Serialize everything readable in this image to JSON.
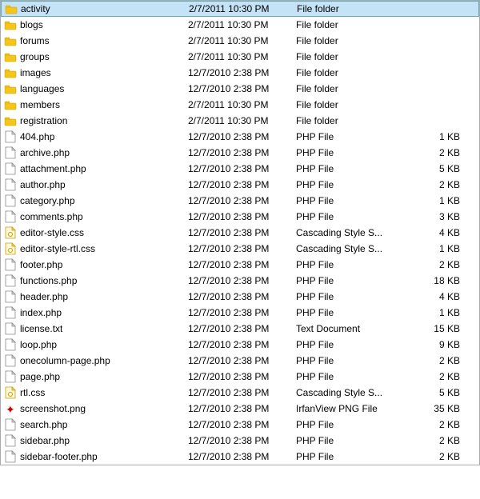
{
  "files": [
    {
      "name": "activity",
      "date": "2/7/2011 10:30 PM",
      "type": "File folder",
      "size": "",
      "icon": "folder"
    },
    {
      "name": "blogs",
      "date": "2/7/2011 10:30 PM",
      "type": "File folder",
      "size": "",
      "icon": "folder"
    },
    {
      "name": "forums",
      "date": "2/7/2011 10:30 PM",
      "type": "File folder",
      "size": "",
      "icon": "folder"
    },
    {
      "name": "groups",
      "date": "2/7/2011 10:30 PM",
      "type": "File folder",
      "size": "",
      "icon": "folder"
    },
    {
      "name": "images",
      "date": "12/7/2010 2:38 PM",
      "type": "File folder",
      "size": "",
      "icon": "folder"
    },
    {
      "name": "languages",
      "date": "12/7/2010 2:38 PM",
      "type": "File folder",
      "size": "",
      "icon": "folder"
    },
    {
      "name": "members",
      "date": "2/7/2011 10:30 PM",
      "type": "File folder",
      "size": "",
      "icon": "folder"
    },
    {
      "name": "registration",
      "date": "2/7/2011 10:30 PM",
      "type": "File folder",
      "size": "",
      "icon": "folder"
    },
    {
      "name": "404.php",
      "date": "12/7/2010 2:38 PM",
      "type": "PHP File",
      "size": "1 KB",
      "icon": "php"
    },
    {
      "name": "archive.php",
      "date": "12/7/2010 2:38 PM",
      "type": "PHP File",
      "size": "2 KB",
      "icon": "php"
    },
    {
      "name": "attachment.php",
      "date": "12/7/2010 2:38 PM",
      "type": "PHP File",
      "size": "5 KB",
      "icon": "php"
    },
    {
      "name": "author.php",
      "date": "12/7/2010 2:38 PM",
      "type": "PHP File",
      "size": "2 KB",
      "icon": "php"
    },
    {
      "name": "category.php",
      "date": "12/7/2010 2:38 PM",
      "type": "PHP File",
      "size": "1 KB",
      "icon": "php"
    },
    {
      "name": "comments.php",
      "date": "12/7/2010 2:38 PM",
      "type": "PHP File",
      "size": "3 KB",
      "icon": "php"
    },
    {
      "name": "editor-style.css",
      "date": "12/7/2010 2:38 PM",
      "type": "Cascading Style S...",
      "size": "4 KB",
      "icon": "css"
    },
    {
      "name": "editor-style-rtl.css",
      "date": "12/7/2010 2:38 PM",
      "type": "Cascading Style S...",
      "size": "1 KB",
      "icon": "css"
    },
    {
      "name": "footer.php",
      "date": "12/7/2010 2:38 PM",
      "type": "PHP File",
      "size": "2 KB",
      "icon": "php"
    },
    {
      "name": "functions.php",
      "date": "12/7/2010 2:38 PM",
      "type": "PHP File",
      "size": "18 KB",
      "icon": "php"
    },
    {
      "name": "header.php",
      "date": "12/7/2010 2:38 PM",
      "type": "PHP File",
      "size": "4 KB",
      "icon": "php"
    },
    {
      "name": "index.php",
      "date": "12/7/2010 2:38 PM",
      "type": "PHP File",
      "size": "1 KB",
      "icon": "php"
    },
    {
      "name": "license.txt",
      "date": "12/7/2010 2:38 PM",
      "type": "Text Document",
      "size": "15 KB",
      "icon": "txt"
    },
    {
      "name": "loop.php",
      "date": "12/7/2010 2:38 PM",
      "type": "PHP File",
      "size": "9 KB",
      "icon": "php"
    },
    {
      "name": "onecolumn-page.php",
      "date": "12/7/2010 2:38 PM",
      "type": "PHP File",
      "size": "2 KB",
      "icon": "php"
    },
    {
      "name": "page.php",
      "date": "12/7/2010 2:38 PM",
      "type": "PHP File",
      "size": "2 KB",
      "icon": "php"
    },
    {
      "name": "rtl.css",
      "date": "12/7/2010 2:38 PM",
      "type": "Cascading Style S...",
      "size": "5 KB",
      "icon": "css"
    },
    {
      "name": "screenshot.png",
      "date": "12/7/2010 2:38 PM",
      "type": "IrfanView PNG File",
      "size": "35 KB",
      "icon": "png"
    },
    {
      "name": "search.php",
      "date": "12/7/2010 2:38 PM",
      "type": "PHP File",
      "size": "2 KB",
      "icon": "php"
    },
    {
      "name": "sidebar.php",
      "date": "12/7/2010 2:38 PM",
      "type": "PHP File",
      "size": "2 KB",
      "icon": "php"
    },
    {
      "name": "sidebar-footer.php",
      "date": "12/7/2010 2:38 PM",
      "type": "PHP File",
      "size": "2 KB",
      "icon": "php"
    }
  ]
}
